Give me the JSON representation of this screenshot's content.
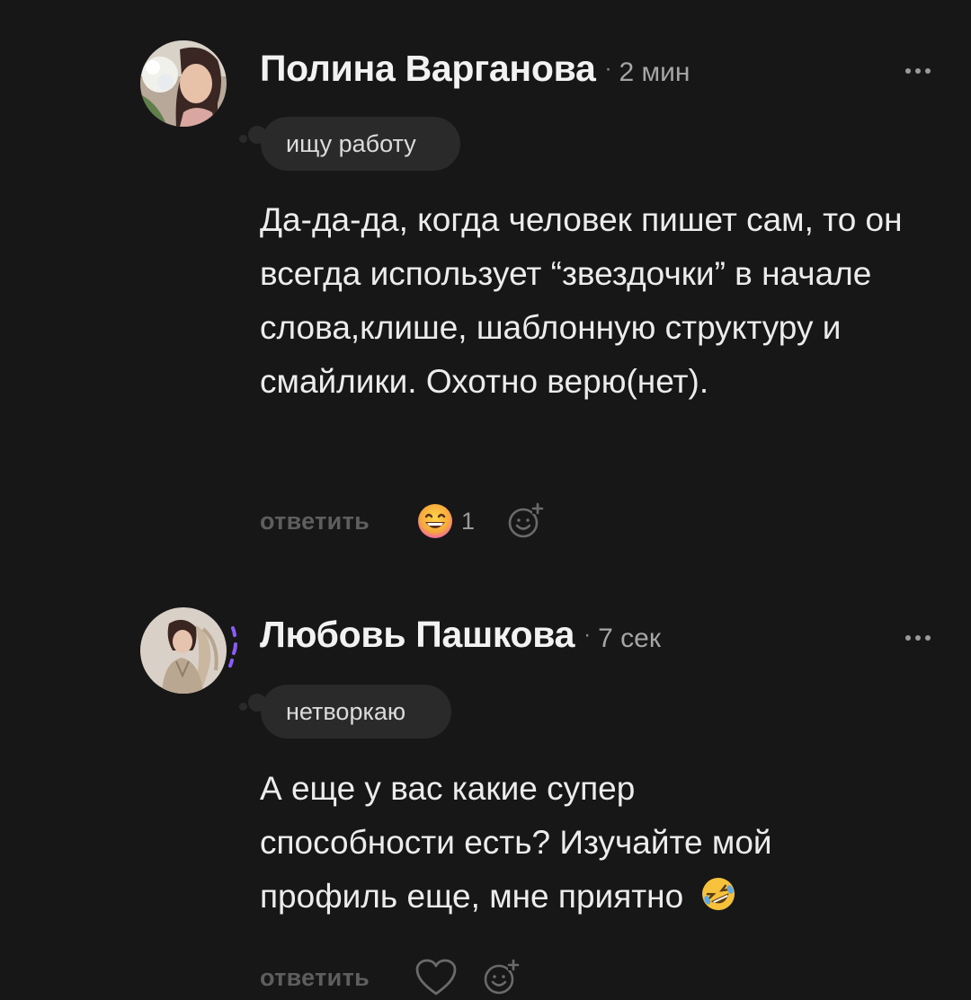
{
  "comments": [
    {
      "author": "Полина Варганова",
      "time_sep": "·",
      "time": "2 мин",
      "status": "ищу работу",
      "text": "Да-да-да, когда человек пишет сам, то он всегда использует “звездочки” в начале слова,клише, шаблонную структуру и смайлики. Охотно верю(нет).",
      "reply_label": "ответить",
      "reaction": {
        "icon": "grinning-face-emoji",
        "count": "1"
      },
      "add_reaction_icon": "add-reaction-icon",
      "more_icon": "more-dots-icon"
    },
    {
      "author": "Любовь Пашкова",
      "time_sep": "·",
      "time": "7 сек",
      "status": "нетворкаю",
      "text": "А еще у вас какие супер способности есть? Изучайте мой профиль еще, мне приятно",
      "text_emoji": "rolling-on-floor-laughing-emoji",
      "reply_label": "ответить",
      "like_icon": "heart-icon",
      "add_reaction_icon": "add-reaction-icon",
      "more_icon": "more-dots-icon"
    }
  ],
  "colors": {
    "background": "#171717",
    "bubble": "#2a2a2a",
    "story_ring": "#8b5cf6"
  }
}
